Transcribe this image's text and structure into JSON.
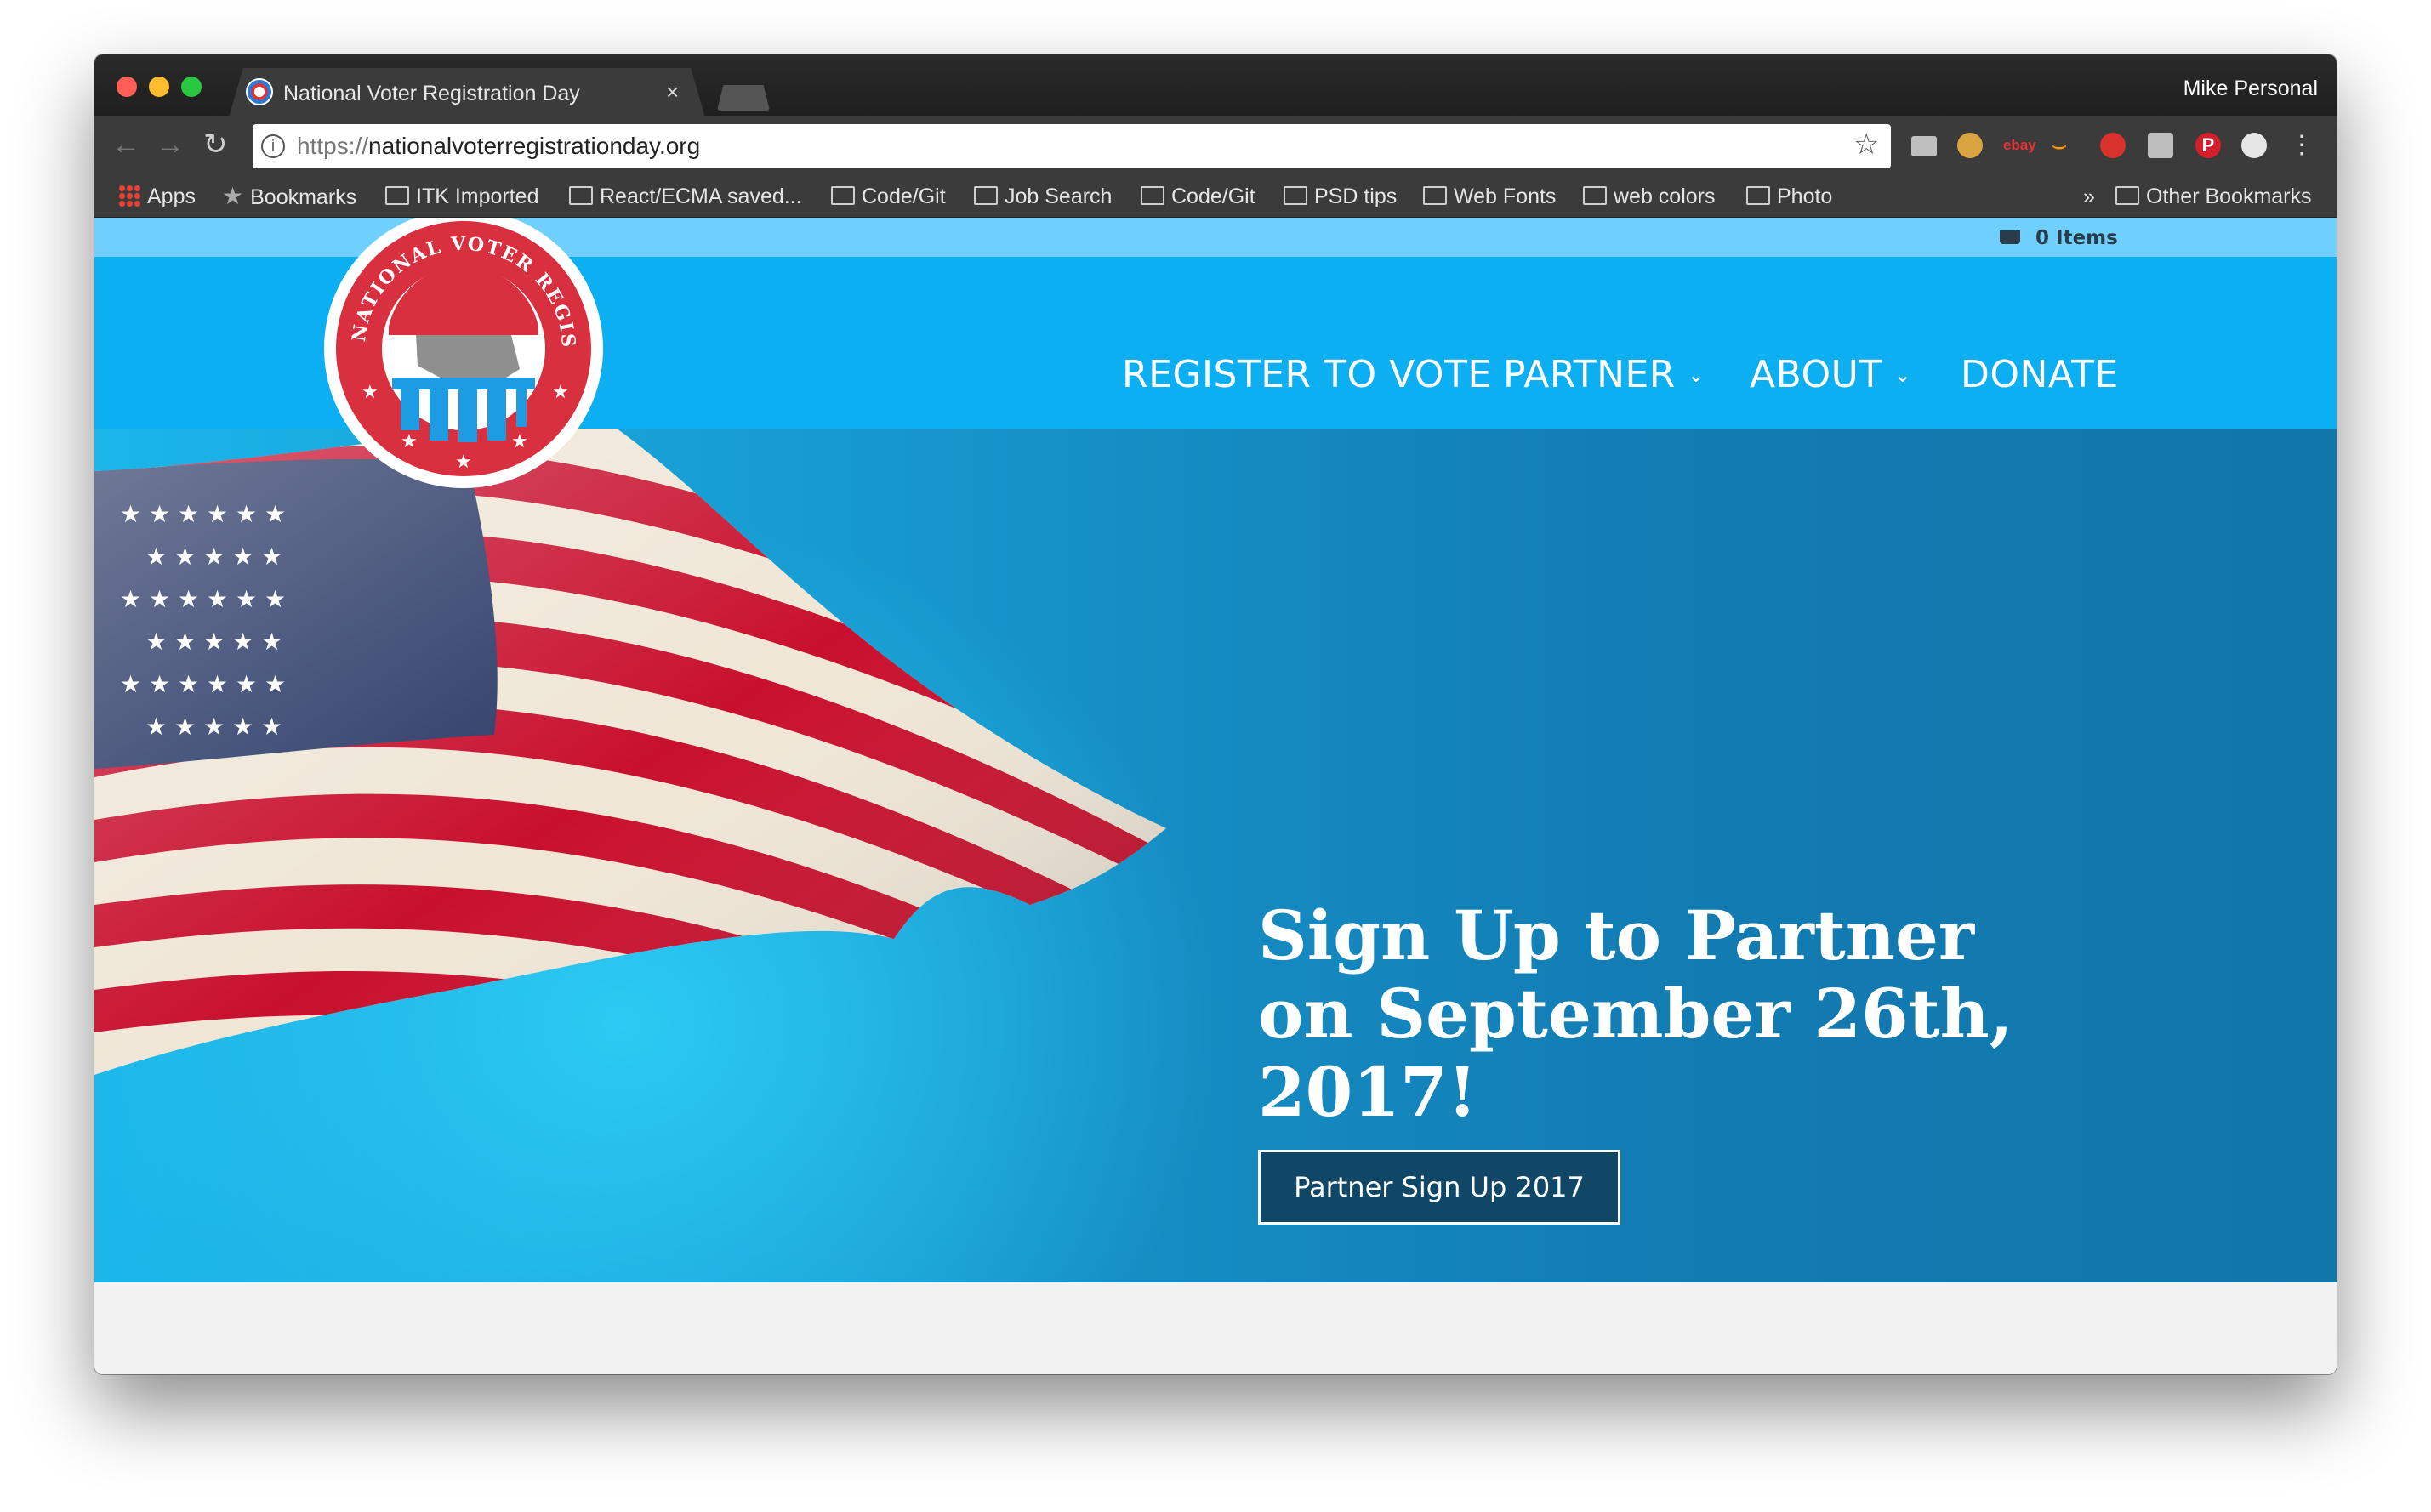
{
  "browser": {
    "tab_title": "National Voter Registration Day",
    "tab_close": "×",
    "profile_name": "Mike Personal",
    "url_scheme": "https://",
    "url_host": "nationalvoterregistrationday.org",
    "info_icon": "i",
    "star_icon": "☆",
    "back_icon": "←",
    "forward_icon": "→",
    "reload_icon": "↻",
    "menu_icon": "⋮",
    "ebay_text": "ebay",
    "abp_text": "ABP",
    "pinterest_text": "P",
    "amazon_text": "⌣"
  },
  "bookmarks": {
    "apps": "Apps",
    "items": [
      "Bookmarks",
      "ITK Imported",
      "React/ECMA saved...",
      "Code/Git",
      "Job Search",
      "Code/Git",
      "PSD tips",
      "Web Fonts",
      "web colors",
      "Photo"
    ],
    "overflow": "»",
    "other": "Other Bookmarks"
  },
  "site": {
    "cart_label": "0 Items",
    "logo_text": "NATIONAL VOTER REGISTRATION DAY",
    "nav": [
      {
        "label": "REGISTER TO VOTE",
        "has_dropdown": false
      },
      {
        "label": "PARTNER",
        "has_dropdown": true
      },
      {
        "label": "ABOUT",
        "has_dropdown": true
      },
      {
        "label": "DONATE",
        "has_dropdown": false
      }
    ],
    "chevron": "⌄",
    "hero": {
      "headline_line1": "Sign Up to Partner",
      "headline_line2": "on September 26th,",
      "headline_line3": "2017!",
      "cta_label": "Partner Sign Up 2017"
    }
  },
  "colors": {
    "topbar": "#6fd0ff",
    "nav_bg": "#0baff2",
    "hero_bg": "#127cb3",
    "cta_bg": "#114766",
    "flag_red": "#c8102e",
    "flag_blue": "#2b3a67"
  }
}
